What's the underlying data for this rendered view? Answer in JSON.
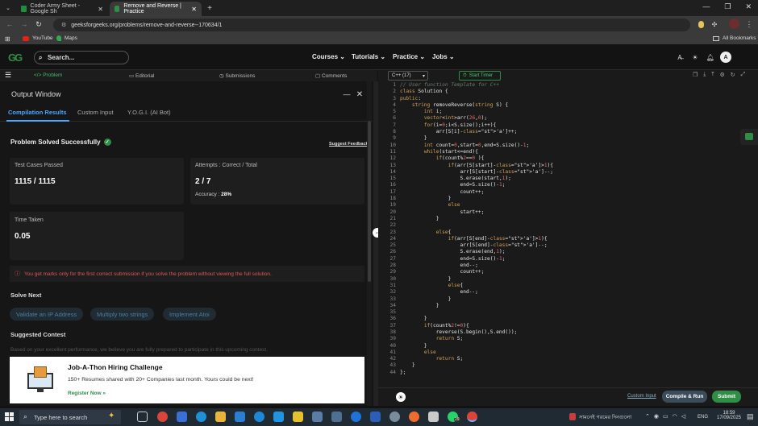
{
  "browser": {
    "tabs": [
      {
        "title": "Coder Army Sheet - Google Sh",
        "icon": "sheets-icon",
        "active": false
      },
      {
        "title": "Remove and Reverse | Practice",
        "icon": "gfg-icon",
        "active": true
      }
    ],
    "new_tab": "+",
    "url": "geeksforgeeks.org/problems/remove-and-reverse--170634/1",
    "bookmarks": [
      "YouTube",
      "Maps"
    ],
    "all_bookmarks": "All Bookmarks",
    "profile_initial": "A"
  },
  "header": {
    "logo": "GG",
    "search_placeholder": "Search...",
    "nav": [
      "Courses",
      "Tutorials",
      "Practice",
      "Jobs"
    ],
    "user_initial": "A"
  },
  "problem_tabs": [
    "Problem",
    "Editorial",
    "Submissions",
    "Comments"
  ],
  "output_window": {
    "title": "Output Window",
    "tabs": [
      "Compilation Results",
      "Custom Input",
      "Y.O.G.I. (AI Bot)"
    ],
    "status": "Problem Solved Successfully",
    "suggest_feedback": "Suggest Feedback",
    "test_cases_label": "Test Cases Passed",
    "test_cases_value": "1115 / 1115",
    "attempts_label": "Attempts : Correct / Total",
    "attempts_value": "2 / 7",
    "accuracy_label": "Accuracy :",
    "accuracy_value": "28%",
    "time_label": "Time Taken",
    "time_value": "0.05",
    "warning": "You get marks only for the first correct submission if you solve the problem without viewing the full solution.",
    "solve_next_title": "Solve Next",
    "solve_next": [
      "Validate an IP Address",
      "Multiply two strings",
      "Implement Atoi"
    ],
    "suggested_contest_title": "Suggested Contest",
    "contest_desc": "Based on your excellent performance, we believe you are fully prepared to participate in this upcoming contest.",
    "ad_title": "Job-A-Thon Hiring Challenge",
    "ad_text": "150+ Resumes shared with 20+ Companies last month. Yours could be next!",
    "ad_link": "Register Now »"
  },
  "editor": {
    "language": "C++ (17)",
    "timer": "Start Timer",
    "custom_input": "Custom Input",
    "compile_run": "Compile & Run",
    "submit": "Submit",
    "accent": "#2f8d46",
    "lines": [
      "// User function Template for C++",
      "class Solution {",
      "public:",
      "    string removeReverse(string S) {",
      "        int i;",
      "        vector<int>arr(26,0);",
      "        for(i=0;i<S.size();i++){",
      "            arr[S[i]-'a']++;",
      "        }",
      "        int count=0,start=0,end=S.size()-1;",
      "        while(start<=end){",
      "            if(count%2==0 ){",
      "                if(arr[S[start]-'a']>1){",
      "                    arr[S[start]-'a']--;",
      "                    S.erase(start,1);",
      "                    end=S.size()-1;",
      "                    count++;",
      "                }",
      "                else",
      "                    start++;",
      "            }",
      "",
      "            else{",
      "                if(arr[S[end]-'a']>1){",
      "                    arr[S[end]-'a']--;",
      "                    S.erase(end,1);",
      "                    end=S.size()-1;",
      "                    end--;",
      "                    count++;",
      "                }",
      "                else{",
      "                    end--;",
      "                }",
      "            }",
      "",
      "        }",
      "        if(count%2!=0){",
      "            reverse(S.begin(),S.end());",
      "            return S;",
      "        }",
      "        else",
      "            return S;",
      "    }",
      "};"
    ]
  },
  "taskbar": {
    "search": "Type here to search",
    "weather_text": "সামনেই গরমের দিনগুলো",
    "lang": "ENG",
    "time": "18:59",
    "date": "17/09/2025",
    "notif_count": "29"
  }
}
